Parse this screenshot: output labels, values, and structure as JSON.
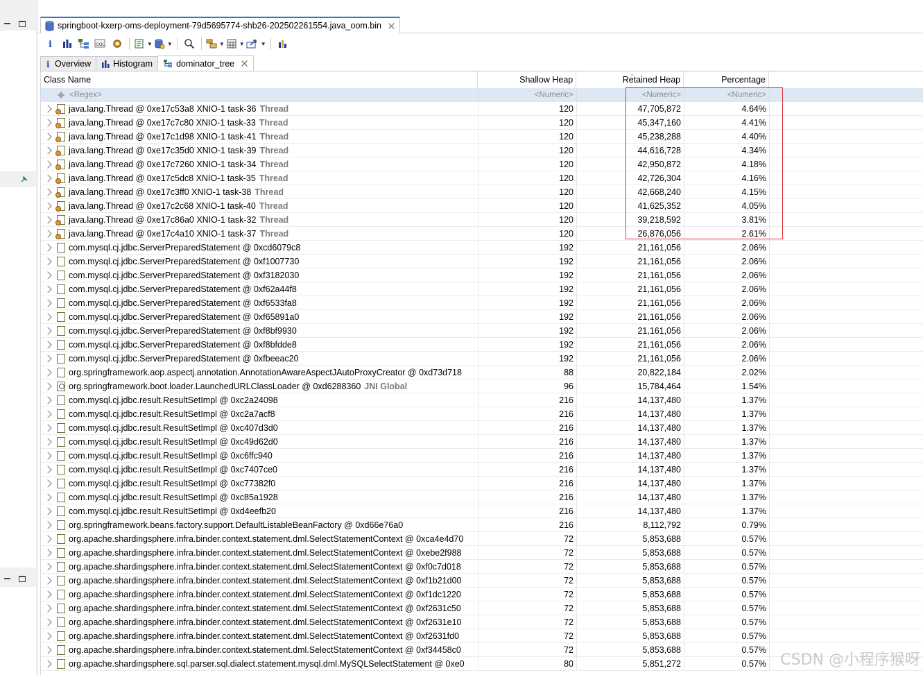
{
  "editor": {
    "file_tab": "springboot-kxerp-oms-deployment-79d5695774-shb26-202502261554.java_oom.bin"
  },
  "toolbar": {
    "icons": [
      "info-icon",
      "histogram-icon",
      "dominator-tree-icon",
      "oql-icon",
      "thread-overview-icon",
      "run-report-icon",
      "query-browser-icon",
      "search-icon",
      "group-by-icon",
      "calculate-heap-icon",
      "export-icon",
      "heap-dump-overview-icon"
    ]
  },
  "subtabs": [
    {
      "label": "Overview",
      "icon": "info-icon",
      "active": false
    },
    {
      "label": "Histogram",
      "icon": "histogram-icon",
      "active": false
    },
    {
      "label": "dominator_tree",
      "icon": "dominator-tree-icon",
      "active": true
    }
  ],
  "table": {
    "headers": {
      "class_name": "Class Name",
      "shallow_heap": "Shallow Heap",
      "retained_heap": "Retained Heap",
      "percentage": "Percentage"
    },
    "filters": {
      "class_name": "<Regex>",
      "shallow_heap": "<Numeric>",
      "retained_heap": "<Numeric>",
      "percentage": "<Numeric>"
    },
    "rows": [
      {
        "name": "java.lang.Thread @ 0xe17c53a8  XNIO-1 task-36",
        "root": "Thread",
        "icon": "thread",
        "shallow": "120",
        "retained": "47,705,872",
        "pct": "4.64%"
      },
      {
        "name": "java.lang.Thread @ 0xe17c7c80  XNIO-1 task-33",
        "root": "Thread",
        "icon": "thread",
        "shallow": "120",
        "retained": "45,347,160",
        "pct": "4.41%"
      },
      {
        "name": "java.lang.Thread @ 0xe17c1d98  XNIO-1 task-41",
        "root": "Thread",
        "icon": "thread",
        "shallow": "120",
        "retained": "45,238,288",
        "pct": "4.40%"
      },
      {
        "name": "java.lang.Thread @ 0xe17c35d0  XNIO-1 task-39",
        "root": "Thread",
        "icon": "thread",
        "shallow": "120",
        "retained": "44,616,728",
        "pct": "4.34%"
      },
      {
        "name": "java.lang.Thread @ 0xe17c7260  XNIO-1 task-34",
        "root": "Thread",
        "icon": "thread",
        "shallow": "120",
        "retained": "42,950,872",
        "pct": "4.18%"
      },
      {
        "name": "java.lang.Thread @ 0xe17c5dc8  XNIO-1 task-35",
        "root": "Thread",
        "icon": "thread",
        "shallow": "120",
        "retained": "42,726,304",
        "pct": "4.16%"
      },
      {
        "name": "java.lang.Thread @ 0xe17c3ff0  XNIO-1 task-38",
        "root": "Thread",
        "icon": "thread",
        "shallow": "120",
        "retained": "42,668,240",
        "pct": "4.15%"
      },
      {
        "name": "java.lang.Thread @ 0xe17c2c68  XNIO-1 task-40",
        "root": "Thread",
        "icon": "thread",
        "shallow": "120",
        "retained": "41,625,352",
        "pct": "4.05%"
      },
      {
        "name": "java.lang.Thread @ 0xe17c86a0  XNIO-1 task-32",
        "root": "Thread",
        "icon": "thread",
        "shallow": "120",
        "retained": "39,218,592",
        "pct": "3.81%"
      },
      {
        "name": "java.lang.Thread @ 0xe17c4a10  XNIO-1 task-37",
        "root": "Thread",
        "icon": "thread",
        "shallow": "120",
        "retained": "26,876,056",
        "pct": "2.61%"
      },
      {
        "name": "com.mysql.cj.jdbc.ServerPreparedStatement @ 0xcd6079c8",
        "root": "",
        "icon": "obj",
        "shallow": "192",
        "retained": "21,161,056",
        "pct": "2.06%"
      },
      {
        "name": "com.mysql.cj.jdbc.ServerPreparedStatement @ 0xf1007730",
        "root": "",
        "icon": "obj",
        "shallow": "192",
        "retained": "21,161,056",
        "pct": "2.06%"
      },
      {
        "name": "com.mysql.cj.jdbc.ServerPreparedStatement @ 0xf3182030",
        "root": "",
        "icon": "obj",
        "shallow": "192",
        "retained": "21,161,056",
        "pct": "2.06%"
      },
      {
        "name": "com.mysql.cj.jdbc.ServerPreparedStatement @ 0xf62a44f8",
        "root": "",
        "icon": "obj",
        "shallow": "192",
        "retained": "21,161,056",
        "pct": "2.06%"
      },
      {
        "name": "com.mysql.cj.jdbc.ServerPreparedStatement @ 0xf6533fa8",
        "root": "",
        "icon": "obj",
        "shallow": "192",
        "retained": "21,161,056",
        "pct": "2.06%"
      },
      {
        "name": "com.mysql.cj.jdbc.ServerPreparedStatement @ 0xf65891a0",
        "root": "",
        "icon": "obj",
        "shallow": "192",
        "retained": "21,161,056",
        "pct": "2.06%"
      },
      {
        "name": "com.mysql.cj.jdbc.ServerPreparedStatement @ 0xf8bf9930",
        "root": "",
        "icon": "obj",
        "shallow": "192",
        "retained": "21,161,056",
        "pct": "2.06%"
      },
      {
        "name": "com.mysql.cj.jdbc.ServerPreparedStatement @ 0xf8bfdde8",
        "root": "",
        "icon": "obj",
        "shallow": "192",
        "retained": "21,161,056",
        "pct": "2.06%"
      },
      {
        "name": "com.mysql.cj.jdbc.ServerPreparedStatement @ 0xfbeeac20",
        "root": "",
        "icon": "obj",
        "shallow": "192",
        "retained": "21,161,056",
        "pct": "2.06%"
      },
      {
        "name": "org.springframework.aop.aspectj.annotation.AnnotationAwareAspectJAutoProxyCreator @ 0xd73d718",
        "root": "",
        "icon": "obj",
        "shallow": "88",
        "retained": "20,822,184",
        "pct": "2.02%"
      },
      {
        "name": "org.springframework.boot.loader.LaunchedURLClassLoader @ 0xd6288360",
        "root": "JNI Global",
        "icon": "gc",
        "shallow": "96",
        "retained": "15,784,464",
        "pct": "1.54%"
      },
      {
        "name": "com.mysql.cj.jdbc.result.ResultSetImpl @ 0xc2a24098",
        "root": "",
        "icon": "obj",
        "shallow": "216",
        "retained": "14,137,480",
        "pct": "1.37%"
      },
      {
        "name": "com.mysql.cj.jdbc.result.ResultSetImpl @ 0xc2a7acf8",
        "root": "",
        "icon": "obj",
        "shallow": "216",
        "retained": "14,137,480",
        "pct": "1.37%"
      },
      {
        "name": "com.mysql.cj.jdbc.result.ResultSetImpl @ 0xc407d3d0",
        "root": "",
        "icon": "obj",
        "shallow": "216",
        "retained": "14,137,480",
        "pct": "1.37%"
      },
      {
        "name": "com.mysql.cj.jdbc.result.ResultSetImpl @ 0xc49d62d0",
        "root": "",
        "icon": "obj",
        "shallow": "216",
        "retained": "14,137,480",
        "pct": "1.37%"
      },
      {
        "name": "com.mysql.cj.jdbc.result.ResultSetImpl @ 0xc6ffc940",
        "root": "",
        "icon": "obj",
        "shallow": "216",
        "retained": "14,137,480",
        "pct": "1.37%"
      },
      {
        "name": "com.mysql.cj.jdbc.result.ResultSetImpl @ 0xc7407ce0",
        "root": "",
        "icon": "obj",
        "shallow": "216",
        "retained": "14,137,480",
        "pct": "1.37%"
      },
      {
        "name": "com.mysql.cj.jdbc.result.ResultSetImpl @ 0xc77382f0",
        "root": "",
        "icon": "obj",
        "shallow": "216",
        "retained": "14,137,480",
        "pct": "1.37%"
      },
      {
        "name": "com.mysql.cj.jdbc.result.ResultSetImpl @ 0xc85a1928",
        "root": "",
        "icon": "obj",
        "shallow": "216",
        "retained": "14,137,480",
        "pct": "1.37%"
      },
      {
        "name": "com.mysql.cj.jdbc.result.ResultSetImpl @ 0xd4eefb20",
        "root": "",
        "icon": "obj",
        "shallow": "216",
        "retained": "14,137,480",
        "pct": "1.37%"
      },
      {
        "name": "org.springframework.beans.factory.support.DefaultListableBeanFactory @ 0xd66e76a0",
        "root": "",
        "icon": "obj",
        "shallow": "216",
        "retained": "8,112,792",
        "pct": "0.79%"
      },
      {
        "name": "org.apache.shardingsphere.infra.binder.context.statement.dml.SelectStatementContext @ 0xca4e4d70",
        "root": "",
        "icon": "obj",
        "shallow": "72",
        "retained": "5,853,688",
        "pct": "0.57%"
      },
      {
        "name": "org.apache.shardingsphere.infra.binder.context.statement.dml.SelectStatementContext @ 0xebe2f988",
        "root": "",
        "icon": "obj",
        "shallow": "72",
        "retained": "5,853,688",
        "pct": "0.57%"
      },
      {
        "name": "org.apache.shardingsphere.infra.binder.context.statement.dml.SelectStatementContext @ 0xf0c7d018",
        "root": "",
        "icon": "obj",
        "shallow": "72",
        "retained": "5,853,688",
        "pct": "0.57%"
      },
      {
        "name": "org.apache.shardingsphere.infra.binder.context.statement.dml.SelectStatementContext @ 0xf1b21d00",
        "root": "",
        "icon": "obj",
        "shallow": "72",
        "retained": "5,853,688",
        "pct": "0.57%"
      },
      {
        "name": "org.apache.shardingsphere.infra.binder.context.statement.dml.SelectStatementContext @ 0xf1dc1220",
        "root": "",
        "icon": "obj",
        "shallow": "72",
        "retained": "5,853,688",
        "pct": "0.57%"
      },
      {
        "name": "org.apache.shardingsphere.infra.binder.context.statement.dml.SelectStatementContext @ 0xf2631c50",
        "root": "",
        "icon": "obj",
        "shallow": "72",
        "retained": "5,853,688",
        "pct": "0.57%"
      },
      {
        "name": "org.apache.shardingsphere.infra.binder.context.statement.dml.SelectStatementContext @ 0xf2631e10",
        "root": "",
        "icon": "obj",
        "shallow": "72",
        "retained": "5,853,688",
        "pct": "0.57%"
      },
      {
        "name": "org.apache.shardingsphere.infra.binder.context.statement.dml.SelectStatementContext @ 0xf2631fd0",
        "root": "",
        "icon": "obj",
        "shallow": "72",
        "retained": "5,853,688",
        "pct": "0.57%"
      },
      {
        "name": "org.apache.shardingsphere.infra.binder.context.statement.dml.SelectStatementContext @ 0xf34458c0",
        "root": "",
        "icon": "obj",
        "shallow": "72",
        "retained": "5,853,688",
        "pct": "0.57%"
      },
      {
        "name": "org.apache.shardingsphere.sql.parser.sql.dialect.statement.mysql.dml.MySQLSelectStatement @ 0xe0",
        "root": "",
        "icon": "obj",
        "shallow": "80",
        "retained": "5,851,272",
        "pct": "0.57%"
      }
    ]
  },
  "watermark": "CSDN @小程序猴呀",
  "colors": {
    "highlight_border": "#e0303a",
    "filter_row_bg": "#dde8f5",
    "active_tab_accent": "#3b6fd4"
  }
}
